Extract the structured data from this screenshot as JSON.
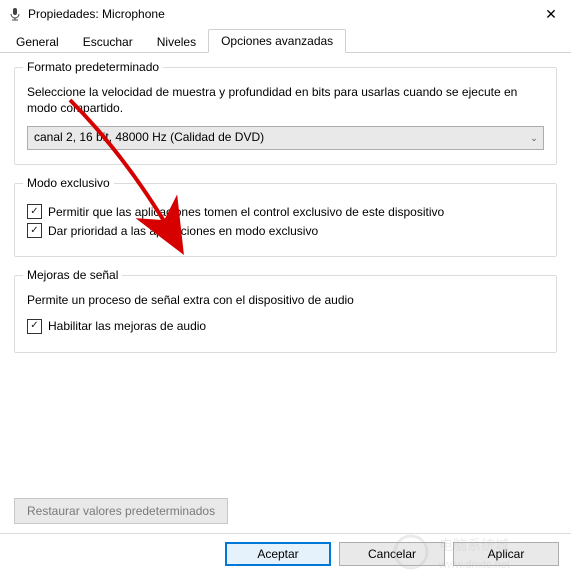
{
  "window": {
    "title": "Propiedades: Microphone"
  },
  "tabs": {
    "general": "General",
    "listen": "Escuchar",
    "levels": "Niveles",
    "advanced": "Opciones avanzadas"
  },
  "default_format": {
    "legend": "Formato predeterminado",
    "desc": "Seleccione la velocidad de muestra y profundidad en bits para usarlas cuando se ejecute en modo compartido.",
    "selected": "canal 2, 16 bit, 48000 Hz (Calidad de DVD)"
  },
  "exclusive_mode": {
    "legend": "Modo exclusivo",
    "allow_exclusive": "Permitir que las aplicaciones tomen el control exclusivo de este dispositivo",
    "priority": "Dar prioridad a las aplicaciones en modo exclusivo"
  },
  "signal_enhancements": {
    "legend": "Mejoras de señal",
    "desc": "Permite un proceso de señal extra con el dispositivo de audio",
    "enable": "Habilitar las mejoras de audio"
  },
  "restore": "Restaurar valores predeterminados",
  "footer": {
    "ok": "Aceptar",
    "cancel": "Cancelar",
    "apply": "Aplicar"
  }
}
